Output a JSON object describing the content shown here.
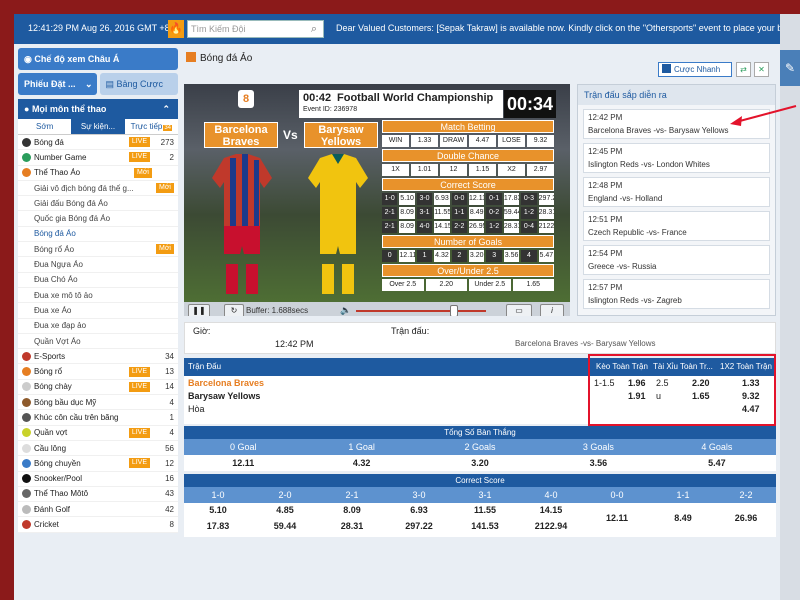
{
  "topbar": {
    "clock": "12:41:29 PM Aug 26, 2016 GMT +8",
    "search_placeholder": "Tìm Kiếm Đội",
    "notice": "Dear Valued Customers: [Sepak Takraw] is available now. Kindly click on the \"Othersports\" event to place your bets now. Thank you!"
  },
  "sidebar": {
    "asia_view": "Chế độ xem Châu Á",
    "bet_slip": "Phiếu Đặt ...",
    "bet_list": "Bảng Cược",
    "all_sports": "Mọi môn thể thao",
    "tabs": [
      "Sớm",
      "Sự kiện...",
      "Trực tiếp"
    ],
    "tab_badge": "34",
    "items": [
      {
        "label": "Bóng đá",
        "live": "LIVE",
        "count": "273",
        "icon_color": "#333"
      },
      {
        "label": "Number Game",
        "live": "LIVE",
        "count": "2",
        "icon_color": "#2a9d5c"
      },
      {
        "label": "Thể Thao Ảo",
        "new": "Mới",
        "count": "",
        "icon_color": "#e67e22"
      },
      {
        "label": "Giải vô địch bóng đá thế g...",
        "new": "Mới",
        "sub": true
      },
      {
        "label": "Giải đấu Bóng đá Ảo",
        "sub": true
      },
      {
        "label": "Quốc gia Bóng đá Ảo",
        "sub": true
      },
      {
        "label": "Bóng đá Ảo",
        "sub": true,
        "selected": true
      },
      {
        "label": "Bóng rổ Ảo",
        "new": "Mới",
        "sub": true
      },
      {
        "label": "Đua Ngựa Ảo",
        "sub": true
      },
      {
        "label": "Đua Chó Ảo",
        "sub": true
      },
      {
        "label": "Đua xe mô tô ảo",
        "sub": true
      },
      {
        "label": "Đua xe Ảo",
        "sub": true
      },
      {
        "label": "Đua xe đạp ảo",
        "sub": true
      },
      {
        "label": "Quần Vợt Ảo",
        "sub": true
      },
      {
        "label": "E-Sports",
        "count": "34",
        "icon_color": "#c0392b"
      },
      {
        "label": "Bóng rổ",
        "live": "LIVE",
        "count": "13",
        "icon_color": "#e67e22"
      },
      {
        "label": "Bóng chày",
        "live": "LIVE",
        "count": "14",
        "icon_color": "#ccc"
      },
      {
        "label": "Bóng bầu dục Mỹ",
        "live": "",
        "count": "4",
        "icon_color": "#8e5a2b"
      },
      {
        "label": "Khúc côn cầu trên băng",
        "count": "1",
        "icon_color": "#555"
      },
      {
        "label": "Quần vợt",
        "live": "LIVE",
        "count": "4",
        "icon_color": "#c9d22a"
      },
      {
        "label": "Cầu lông",
        "count": "56",
        "icon_color": "#ddd"
      },
      {
        "label": "Bóng chuyền",
        "live": "LIVE",
        "count": "12",
        "icon_color": "#3a7bc8"
      },
      {
        "label": "Snooker/Pool",
        "count": "16",
        "icon_color": "#111"
      },
      {
        "label": "Thể Thao Môtô",
        "count": "43",
        "icon_color": "#666"
      },
      {
        "label": "Đánh Golf",
        "count": "42",
        "icon_color": "#bbb"
      },
      {
        "label": "Cricket",
        "count": "8",
        "icon_color": "#c0392b"
      }
    ]
  },
  "main": {
    "title": "Bóng đá Ảo",
    "quick_bet": "Cược Nhanh"
  },
  "video": {
    "time": "00:42",
    "title": "Football World Championship",
    "event_id": "Event ID: 236978",
    "clock": "00:34",
    "team_a": "Barcelona Braves",
    "team_b": "Barysaw Yellows",
    "vs": "Vs",
    "buffer": "Buffer: 1.688secs",
    "match_betting": {
      "head": "Match Betting",
      "cells": [
        "WIN",
        "1.33",
        "DRAW",
        "4.47",
        "LOSE",
        "9.32"
      ]
    },
    "double_chance": {
      "head": "Double Chance",
      "cells": [
        "1X",
        "1.01",
        "12",
        "1.15",
        "X2",
        "2.97"
      ]
    },
    "correct_score": {
      "head": "Correct Score",
      "rows": [
        [
          "1-0",
          "5.10",
          "3-0",
          "6.93",
          "0-0",
          "12.11",
          "0-1",
          "17.83",
          "0-3",
          "297.22"
        ],
        [
          "2-1",
          "8.09",
          "3-1",
          "11.55",
          "1-1",
          "8.49",
          "0-2",
          "59.44",
          "1-2",
          "28.31"
        ],
        [
          "2-1",
          "8.09",
          "4-0",
          "14.15",
          "2-2",
          "26.95",
          "1-2",
          "28.31",
          "0-4",
          "2122.94"
        ]
      ]
    },
    "num_goals": {
      "head": "Number of Goals",
      "cells": [
        "0",
        "12.11",
        "1",
        "4.32",
        "2",
        "3.20",
        "3",
        "3.56",
        "4",
        "5.47"
      ]
    },
    "over_under": {
      "head": "Over/Under 2.5",
      "cells": [
        "Over 2.5",
        "2.20",
        "Under 2.5",
        "1.65"
      ]
    }
  },
  "upcoming": {
    "title": "Trận đấu sắp diễn ra",
    "items": [
      {
        "time": "12:42 PM",
        "match": "Barcelona Braves -vs- Barysaw Yellows"
      },
      {
        "time": "12:45 PM",
        "match": "Islington Reds -vs- London Whites"
      },
      {
        "time": "12:48 PM",
        "match": "England -vs- Holland"
      },
      {
        "time": "12:51 PM",
        "match": "Czech Republic -vs- France"
      },
      {
        "time": "12:54 PM",
        "match": "Greece -vs- Russia"
      },
      {
        "time": "12:57 PM",
        "match": "Islington Reds -vs- Zagreb"
      }
    ]
  },
  "match_info": {
    "time_label": "Giờ:",
    "time_value": "12:42 PM",
    "match_label": "Trận đấu:",
    "match_value": "Barcelona Braves -vs- Barysaw Yellows"
  },
  "odds_table": {
    "headers": [
      "Trận Đấu",
      "Kèo Toàn Trận",
      "Tài Xỉu Toàn Tr...",
      "1X2 Toàn Trận"
    ],
    "rows": [
      {
        "team": "Barcelona Braves",
        "hdp": "1-1.5",
        "hdp_odds": "1.96",
        "ou": "2.5",
        "ou_odds": "2.20",
        "x12": "1.33"
      },
      {
        "team": "Barysaw Yellows",
        "hdp": "",
        "hdp_odds": "1.91",
        "ou": "u",
        "ou_odds": "1.65",
        "x12": "9.32"
      },
      {
        "team": "Hòa",
        "hdp": "",
        "hdp_odds": "",
        "ou": "",
        "ou_odds": "",
        "x12": "4.47"
      }
    ]
  },
  "total_goals": {
    "title": "Tổng Số Bàn Thắng",
    "labels": [
      "0 Goal",
      "1 Goal",
      "2 Goals",
      "3 Goals",
      "4 Goals"
    ],
    "values": [
      "12.11",
      "4.32",
      "3.20",
      "3.56",
      "5.47"
    ]
  },
  "correct_score": {
    "title": "Correct Score",
    "labels": [
      "1-0",
      "2-0",
      "2-1",
      "3-0",
      "3-1",
      "4-0",
      "0-0",
      "1-1",
      "2-2"
    ],
    "row1": [
      "5.10",
      "4.85",
      "8.09",
      "6.93",
      "11.55",
      "14.15"
    ],
    "row2": [
      "17.83",
      "59.44",
      "28.31",
      "297.22",
      "141.53",
      "2122.94"
    ],
    "draws": [
      "12.11",
      "8.49",
      "26.96"
    ]
  }
}
